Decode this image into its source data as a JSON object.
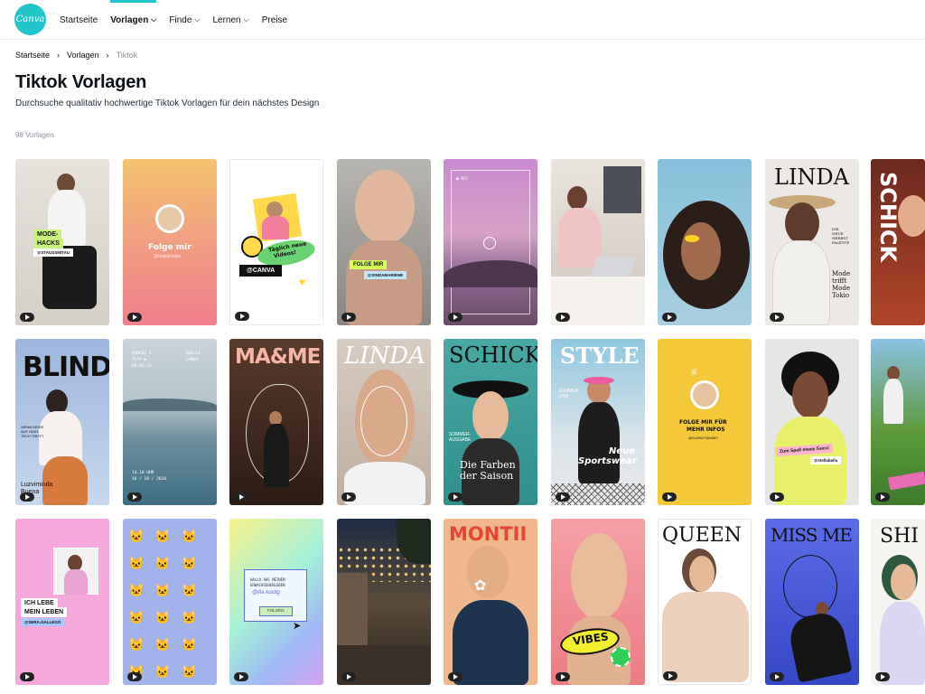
{
  "header": {
    "logo_text": "Canva",
    "nav": [
      {
        "label": "Startseite",
        "has_menu": false,
        "active": false
      },
      {
        "label": "Vorlagen",
        "has_menu": true,
        "active": true
      },
      {
        "label": "Finde",
        "has_menu": true,
        "active": false
      },
      {
        "label": "Lernen",
        "has_menu": true,
        "active": false
      },
      {
        "label": "Preise",
        "has_menu": false,
        "active": false
      }
    ]
  },
  "breadcrumb": [
    "Startseite",
    "Vorlagen",
    "Tiktok"
  ],
  "page": {
    "title": "Tiktok Vorlagen",
    "subtitle": "Durchsuche qualitativ hochwertige Tiktok Vorlagen für dein nächstes Design",
    "count": "98 Vorlagen"
  },
  "templates": [
    {
      "texts": [
        "MODE-",
        "HACKS",
        "@STAUSSMITAU"
      ]
    },
    {
      "texts": [
        "Folge mir",
        "@maksimakk"
      ]
    },
    {
      "texts": [
        "Täglich neue",
        "Videos!",
        "@CANVA"
      ]
    },
    {
      "texts": [
        "FOLGE MIR",
        "@SINDAMARIENE"
      ]
    },
    {
      "texts": [
        "● REC"
      ]
    },
    {
      "texts": []
    },
    {
      "texts": []
    },
    {
      "texts": [
        "LINDA",
        "DIE",
        "NEUE",
        "HERBST",
        "PALETTE",
        "Mode",
        "trifft",
        "Mode",
        "Tokio"
      ]
    },
    {
      "texts": [
        "SCHICK"
      ]
    },
    {
      "texts": [
        "BLIND",
        "WENN MODE",
        "AUF HIGH-",
        "TECH TRIFFT",
        "Luzviminda",
        "Buena"
      ]
    },
    {
      "texts": [
        "KAMERA 1",
        "PLAY ▶",
        "00:05:21",
        "QUELLE",
        "CANVA",
        "14.10 UHR",
        "16 / 10 / 2020"
      ]
    },
    {
      "texts": [
        "MA&ME"
      ]
    },
    {
      "texts": [
        "LINDA"
      ]
    },
    {
      "texts": [
        "SCHICK",
        "SOMMER-",
        "AUSGABE",
        "Die Farben",
        "der Saison"
      ]
    },
    {
      "texts": [
        "STYLE",
        "SOMMER",
        "2020",
        "Neue",
        "Sportswear"
      ]
    },
    {
      "texts": [
        "FOLGE MIR FÜR",
        "MEHR INFOS",
        "@SUNNYSAMMY"
      ]
    },
    {
      "texts": [
        "Zum Spaß etwas Gucci",
        "@stellabella"
      ]
    },
    {
      "texts": []
    },
    {
      "texts": [
        "ICH LEBE",
        "MEIN LEBEN",
        "@SERA.GALLEGO"
      ]
    },
    {
      "texts": []
    },
    {
      "texts": [
        "HALLO AUS MEINEM",
        "ERWACHSENENLEBEN",
        "@lila kustig",
        "FOLGEN"
      ]
    },
    {
      "texts": []
    },
    {
      "texts": [
        "MONTII"
      ]
    },
    {
      "texts": [
        "VIBES"
      ]
    },
    {
      "texts": [
        "QUEEN"
      ]
    },
    {
      "texts": [
        "MISS ME"
      ]
    },
    {
      "texts": [
        "SHI"
      ]
    }
  ]
}
